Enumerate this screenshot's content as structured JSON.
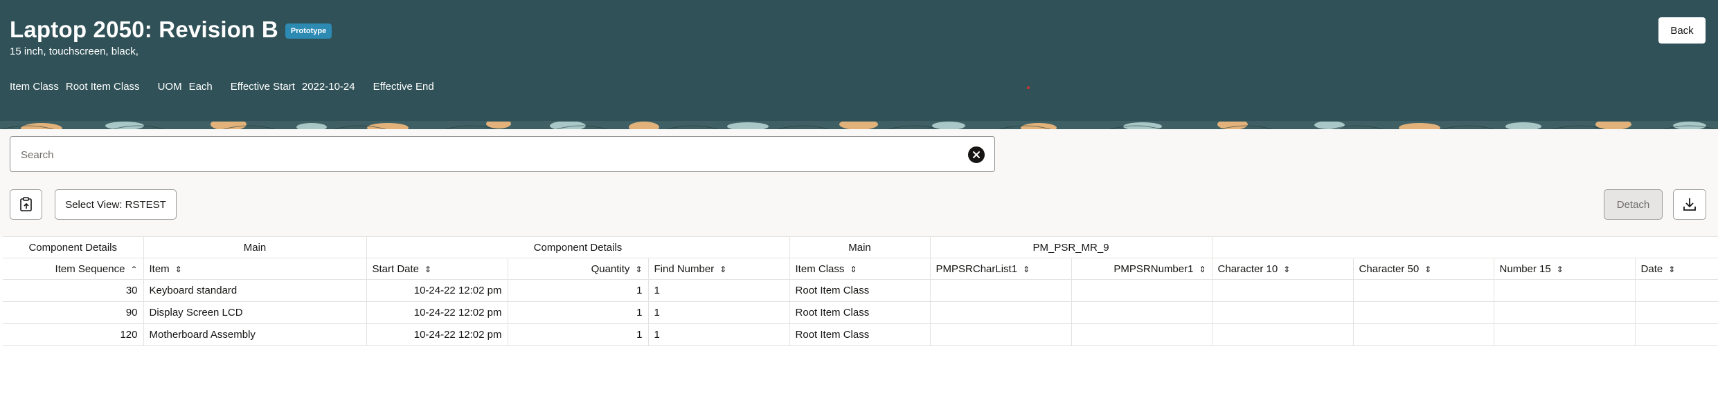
{
  "header": {
    "title": "Laptop 2050: Revision B",
    "badge": "Prototype",
    "subtitle": "15 inch, touchscreen, black,",
    "meta": [
      {
        "label": "Item Class",
        "value": "Root Item Class"
      },
      {
        "label": "UOM",
        "value": "Each"
      },
      {
        "label": "Effective Start",
        "value": "2022-10-24"
      },
      {
        "label": "Effective End",
        "value": ""
      }
    ],
    "back_label": "Back"
  },
  "search": {
    "placeholder": "Search",
    "value": ""
  },
  "toolbar": {
    "select_view_label": "Select View: RSTEST",
    "detach_label": "Detach"
  },
  "table": {
    "groups": [
      "Component Details",
      "Main",
      "Component Details",
      "Main",
      "PM_PSR_MR_9",
      ""
    ],
    "columns": [
      "Item Sequence",
      "Item",
      "Start Date",
      "Quantity",
      "Find Number",
      "Item Class",
      "PMPSRCharList1",
      "PMPSRNumber1",
      "Character 10",
      "Character 50",
      "Number 15",
      "Date"
    ],
    "rows": [
      [
        "30",
        "Keyboard standard",
        "10-24-22 12:02 pm",
        "1",
        "1",
        "Root Item Class",
        "",
        "",
        "",
        "",
        "",
        ""
      ],
      [
        "90",
        "Display Screen LCD",
        "10-24-22 12:02 pm",
        "1",
        "1",
        "Root Item Class",
        "",
        "",
        "",
        "",
        "",
        ""
      ],
      [
        "120",
        "Motherboard Assembly",
        "10-24-22 12:02 pm",
        "1",
        "1",
        "Root Item Class",
        "",
        "",
        "",
        "",
        "",
        ""
      ]
    ]
  },
  "colors": {
    "header_bg": "#2f5157",
    "badge_bg": "#2d8ab3",
    "content_bg": "#f9f8f6"
  },
  "icons": [
    "close-icon",
    "clipboard-upload-icon",
    "download-icon",
    "sort-ascending-icon",
    "sort-icon"
  ]
}
